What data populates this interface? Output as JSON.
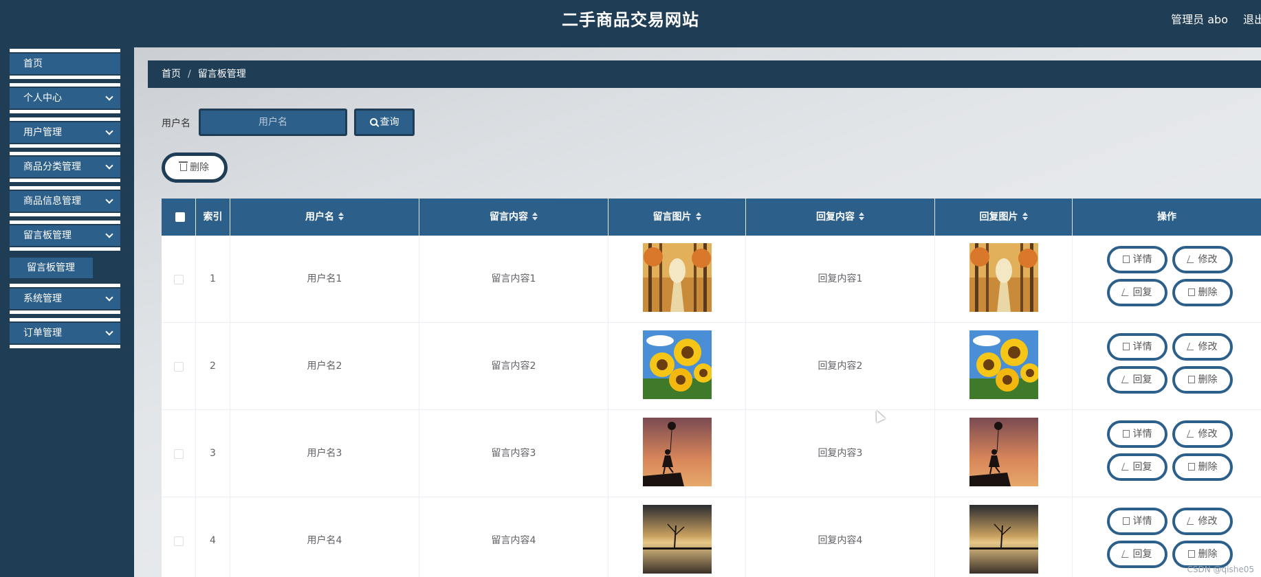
{
  "header": {
    "title": "二手商品交易网站",
    "user": "管理员 abo",
    "logout": "退出"
  },
  "sidebar": {
    "items": [
      {
        "label": "首页",
        "has_children": false
      },
      {
        "label": "个人中心",
        "has_children": true
      },
      {
        "label": "用户管理",
        "has_children": true
      },
      {
        "label": "商品分类管理",
        "has_children": true
      },
      {
        "label": "商品信息管理",
        "has_children": true
      },
      {
        "label": "留言板管理",
        "has_children": true
      },
      {
        "label": "系统管理",
        "has_children": true
      },
      {
        "label": "订单管理",
        "has_children": true
      }
    ],
    "submenu": {
      "label": "留言板管理"
    }
  },
  "breadcrumb": {
    "home": "首页",
    "separator": "/",
    "current": "留言板管理"
  },
  "search": {
    "label": "用户名",
    "placeholder": "用户名",
    "button": "查询"
  },
  "toolbar": {
    "delete_label": "删除"
  },
  "table": {
    "columns": [
      "索引",
      "用户名",
      "留言内容",
      "留言图片",
      "回复内容",
      "回复图片",
      "操作"
    ],
    "rows": [
      {
        "index": "1",
        "username": "用户名1",
        "content": "留言内容1",
        "reply": "回复内容1",
        "image": "autumn-forest-image"
      },
      {
        "index": "2",
        "username": "用户名2",
        "content": "留言内容2",
        "reply": "回复内容2",
        "image": "sunflowers-image"
      },
      {
        "index": "3",
        "username": "用户名3",
        "content": "留言内容3",
        "reply": "回复内容3",
        "image": "girl-balloon-sunset-image"
      },
      {
        "index": "4",
        "username": "用户名4",
        "content": "留言内容4",
        "reply": "回复内容4",
        "image": "lake-tree-sunset-image"
      }
    ],
    "actions": {
      "detail": "详情",
      "edit": "修改",
      "reply": "回复",
      "delete": "删除"
    }
  },
  "watermark": "CSDN @qishe05",
  "colors": {
    "header_bg": "#1f3d55",
    "menu_item_bg": "#2c5f8a",
    "table_header_bg": "#2c5f8a"
  }
}
